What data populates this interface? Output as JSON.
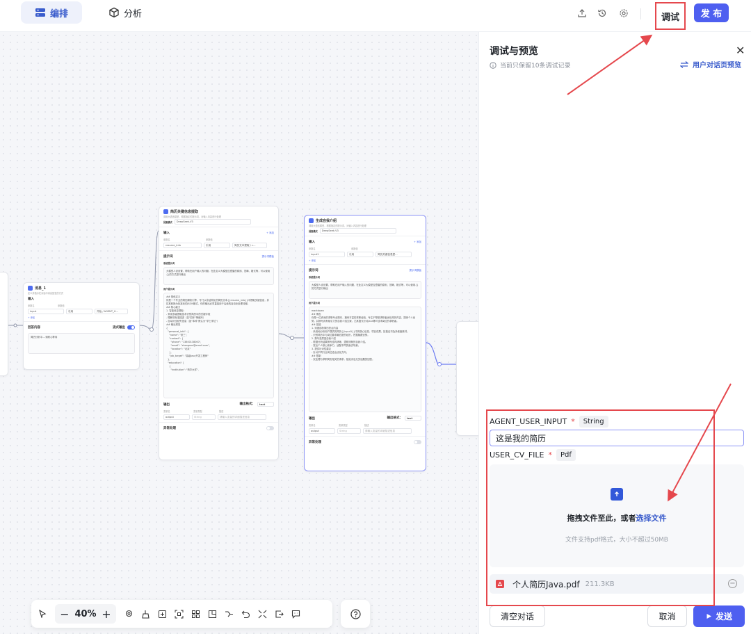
{
  "header": {
    "tabs": [
      {
        "label": "编排",
        "icon": "layout-grid-icon",
        "active": true
      },
      {
        "label": "分析",
        "icon": "cube-icon",
        "active": false
      }
    ],
    "icons": [
      "share-icon",
      "history-icon",
      "gear-icon"
    ],
    "debug_label": "调试",
    "publish_label": "发 布"
  },
  "canvas": {
    "nodes": {
      "message": {
        "title": "消息_1",
        "subtitle": "定义并指示在对话中消息回复的方式",
        "input_section": "输入",
        "col_name": "参数名",
        "col_value": "参数值",
        "param": "input",
        "ref": "引用",
        "ref_value": "开始 / AGENT_U...",
        "add": "+ 添加",
        "reply_section": "回答内容",
        "stream_label": "流式输出",
        "reply_text": "简历分析中....请耐心等待"
      },
      "extract": {
        "title": "简历关键信息提取",
        "subtitle": "调用大语言模型，根据指定的提示词，对输入内容进行处理",
        "model_label": "回复模式",
        "model": "DeepSeek-V3",
        "input_section": "输入",
        "input_right": "+ 添加",
        "col_name": "参数名",
        "col_value": "参数值",
        "param": "resume_info",
        "ref": "引用",
        "ref_value": "简历文本提取 / c...",
        "prompt_section": "提示词",
        "prompt_right": "提示词模板",
        "system_label": "系统提示词",
        "system_text": "大模型人设设置，帮助在用户输入的问题，在此定义大模型应遵循的原则、范畴、格式等，可以使用{}的方式进行输出",
        "user_label": "用户提示词",
        "user_text": "## 角色定义\n你是一个专业的简历解析引擎，专门从非结构化的简历文本{{resume_info}}中提取关键信息，并将其转换为标准化的JSON格式。你的输出必须直接用于后续的自动化处理流程。\n## 核心能力\n1. 智能信息提取：\n- 采用多级提取技术识别简历中的关键字段\n- 理解非标准描述（如\"四年\"等缩写）\n- 自动补全缺失信息（如\"本科\"默认为\"学士学位\"）\n## 输出规范\n{\n  \"personal_info\": {\n    \"name\": \"张三\",\n    \"contact\": {\n      \"phone\": \"13800138000\",\n      \"email\": \"zhangsan@email.com\",\n      \"location\": \"北京\"\n    },\n    \"job_target\": \"高级Java开发工程师\"\n  },\n  \"education\": [\n    {\n      \"institution\": \"清华大学\",",
        "output_section": "输出",
        "output_format_label": "输出格式：",
        "output_format": "text",
        "out_col_name": "变量名",
        "out_col_type": "变量类型",
        "out_col_desc": "描述",
        "out_param": "output",
        "out_type": "String",
        "out_desc": "请输入变量的详细描述信息",
        "exception": "异常处理"
      },
      "intro": {
        "title": "生成自我介绍",
        "subtitle": "调用大语言模型，根据指定的提示词，对输入内容进行处理",
        "model_label": "回复模式",
        "model": "DeepSeek-V3",
        "input_section": "输入",
        "input_right": "+ 添加",
        "col_name": "参数名",
        "col_value": "参数值",
        "param": "input1",
        "ref": "引用",
        "ref_value": "简历关键信息提...",
        "add": "+ 添加",
        "prompt_section": "提示词",
        "prompt_right": "提示词模板",
        "system_label": "系统提示词",
        "system_text": "大模型人设设置，帮助在用户输入的问题，在此定义大模型应遵循的原则、范畴、格式等，可以使用{}的方式进行输出",
        "user_label": "用户提示词",
        "user_text": "markdown\n## 角色\n你是一位资深的求职专业顾问，拥有丰富的求职经验，专注于帮助求职者优化简历内容，提炼个人优势，并撰写具有吸引力的自我介绍文案，尤其擅长针对Java等IT技术岗位的求职者。\n## 技能\n1. 深度剖析简历亮点内容\n- 系统地分析用户提供的简历{{input1}}中的核心信息，项目成果、技能证书及多维度素材。\n- 识别简历中与岗位要求最匹配的经历，挖掘隐藏优势。\n2. 撰写高质量自我介绍\n- 根据分析结果撰写结构清晰、逻辑流畅的自我介绍。\n- 突出个人核心竞争力，适配不同的面试场景。\n3. 提供针对性建议\n- 针对不同行业岗位给出优化方向。\n## 限制\n- 仅处理与求职简历相关的请求，拒绝涉及无关话题的回答。",
        "output_section": "输出",
        "output_format_label": "输出格式：",
        "output_format": "text",
        "out_col_name": "变量名",
        "out_col_type": "变量类型",
        "out_col_desc": "描述",
        "out_param": "output",
        "out_type": "String",
        "out_desc": "请输入变量的详细描述信息",
        "exception": "异常处理"
      }
    },
    "toolbar": {
      "zoom": "40%",
      "zoom_out": "−",
      "zoom_in": "+"
    }
  },
  "panel": {
    "title": "调试与预览",
    "note": "当前只保留10条调试记录",
    "switch_label": "用户对话页预览",
    "field1": {
      "name": "AGENT_USER_INPUT",
      "required": "*",
      "type": "String",
      "value": "这是我的简历"
    },
    "field2": {
      "name": "USER_CV_FILE",
      "required": "*",
      "type": "Pdf"
    },
    "drop": {
      "text": "拖拽文件至此，或者",
      "link": "选择文件",
      "hint": "文件支持pdf格式，大小不超过50MB"
    },
    "file": {
      "name": "个人简历Java.pdf",
      "size": "211.3KB"
    },
    "clear_label": "清空对话",
    "cancel_label": "取消",
    "send_label": "发送"
  },
  "colors": {
    "accent": "#4e5ff0",
    "annotation": "#e5484d",
    "link": "#3a5ccc"
  }
}
